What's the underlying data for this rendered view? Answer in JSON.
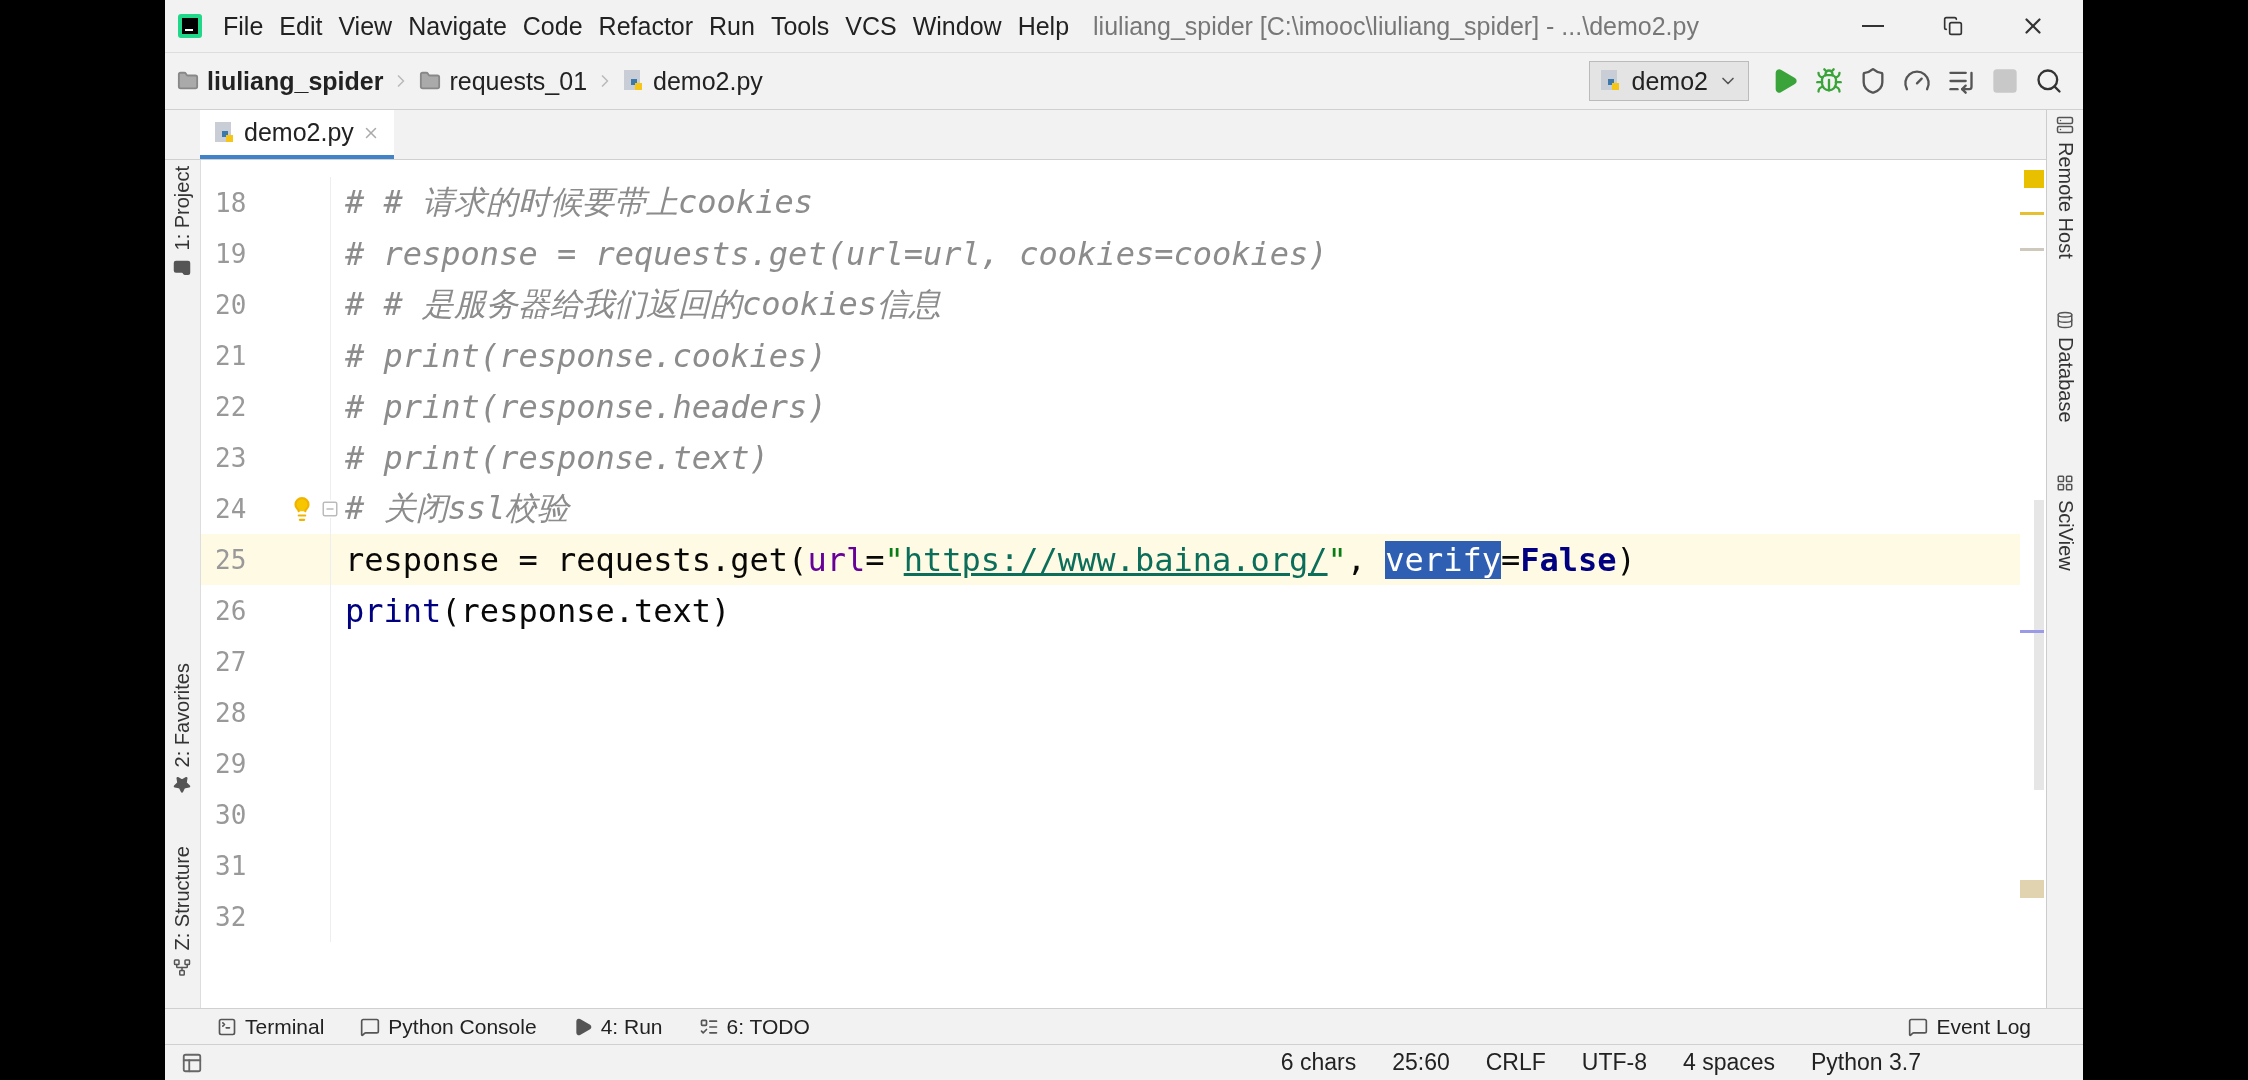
{
  "window": {
    "title": "liuliang_spider [C:\\imooc\\liuliang_spider] - ...\\demo2.py"
  },
  "menu": [
    "File",
    "Edit",
    "View",
    "Navigate",
    "Code",
    "Refactor",
    "Run",
    "Tools",
    "VCS",
    "Window",
    "Help"
  ],
  "breadcrumbs": [
    {
      "label": "liuliang_spider",
      "kind": "project"
    },
    {
      "label": "requests_01",
      "kind": "folder"
    },
    {
      "label": "demo2.py",
      "kind": "file"
    }
  ],
  "run_config": {
    "label": "demo2"
  },
  "toolbar": [
    {
      "kind": "run",
      "disabled": false
    },
    {
      "kind": "debug",
      "disabled": false
    },
    {
      "kind": "coverage",
      "disabled": false
    },
    {
      "kind": "profile",
      "disabled": false
    },
    {
      "kind": "concurrency",
      "disabled": false
    },
    {
      "kind": "stop",
      "disabled": true
    },
    {
      "kind": "search",
      "disabled": false
    }
  ],
  "tabs": [
    {
      "label": "demo2.py",
      "selected": true
    }
  ],
  "left_tools": [
    {
      "label": "1: Project",
      "kind": "folder"
    },
    {
      "label": "2: Favorites",
      "kind": "star"
    },
    {
      "label": "Z: Structure",
      "kind": "structure"
    }
  ],
  "right_tools": [
    {
      "label": "Remote Host",
      "kind": "server"
    },
    {
      "label": "Database",
      "kind": "database"
    },
    {
      "label": "SciView",
      "kind": "grid"
    }
  ],
  "editor": {
    "lines": [
      {
        "number": "18",
        "current": false,
        "fold": false,
        "bulb": false,
        "tokens": [
          {
            "text": "# # 请求的时候要带上cookies",
            "kind": "comment",
            "selected": false
          }
        ]
      },
      {
        "number": "19",
        "current": false,
        "fold": false,
        "bulb": false,
        "tokens": [
          {
            "text": "# response = requests.get(url=url, cookies=cookies)",
            "kind": "comment",
            "selected": false
          }
        ]
      },
      {
        "number": "20",
        "current": false,
        "fold": false,
        "bulb": false,
        "tokens": [
          {
            "text": "# # 是服务器给我们返回的cookies信息",
            "kind": "comment",
            "selected": false
          }
        ]
      },
      {
        "number": "21",
        "current": false,
        "fold": false,
        "bulb": false,
        "tokens": [
          {
            "text": "# print(response.cookies)",
            "kind": "comment",
            "selected": false
          }
        ]
      },
      {
        "number": "22",
        "current": false,
        "fold": false,
        "bulb": false,
        "tokens": [
          {
            "text": "# print(response.headers)",
            "kind": "comment",
            "selected": false
          }
        ]
      },
      {
        "number": "23",
        "current": false,
        "fold": false,
        "bulb": false,
        "tokens": [
          {
            "text": "# print(response.text)",
            "kind": "comment",
            "selected": false
          }
        ]
      },
      {
        "number": "24",
        "current": false,
        "fold": true,
        "bulb": true,
        "tokens": [
          {
            "text": "# 关闭ssl校验",
            "kind": "comment",
            "selected": false
          }
        ]
      },
      {
        "number": "25",
        "current": true,
        "fold": false,
        "bulb": false,
        "tokens": [
          {
            "text": "response = requests.get(",
            "kind": "plain",
            "selected": false
          },
          {
            "text": "url",
            "kind": "param",
            "selected": false
          },
          {
            "text": "=",
            "kind": "plain",
            "selected": false
          },
          {
            "text": "\"",
            "kind": "string",
            "selected": false
          },
          {
            "text": "https://www.baina.org/",
            "kind": "link",
            "selected": false
          },
          {
            "text": "\"",
            "kind": "string",
            "selected": false
          },
          {
            "text": ", ",
            "kind": "plain",
            "selected": false
          },
          {
            "text": "verify",
            "kind": "param",
            "selected": true
          },
          {
            "text": "=",
            "kind": "plain",
            "selected": false
          },
          {
            "text": "False",
            "kind": "keyword",
            "selected": false
          },
          {
            "text": ")",
            "kind": "plain",
            "selected": false
          }
        ]
      },
      {
        "number": "26",
        "current": false,
        "fold": false,
        "bulb": false,
        "tokens": [
          {
            "text": "print",
            "kind": "builtin",
            "selected": false
          },
          {
            "text": "(response.text)",
            "kind": "plain",
            "selected": false
          }
        ]
      },
      {
        "number": "27",
        "current": false,
        "fold": false,
        "bulb": false
      },
      {
        "number": "28",
        "current": false,
        "fold": false,
        "bulb": false
      },
      {
        "number": "29",
        "current": false,
        "fold": false,
        "bulb": false
      },
      {
        "number": "30",
        "current": false,
        "fold": false,
        "bulb": false
      },
      {
        "number": "31",
        "current": false,
        "fold": false,
        "bulb": false
      },
      {
        "number": "32",
        "current": false,
        "fold": false,
        "bulb": false
      }
    ]
  },
  "bottom_tools": [
    {
      "label": "Terminal",
      "kind": "terminal"
    },
    {
      "label": "Python Console",
      "kind": "console"
    },
    {
      "label": "4: Run",
      "kind": "run"
    },
    {
      "label": "6: TODO",
      "kind": "todo"
    }
  ],
  "event_log": {
    "label": "Event Log"
  },
  "status_bar": [
    "6 chars",
    "25:60",
    "CRLF",
    "UTF-8",
    "4 spaces",
    "Python 3.7"
  ]
}
